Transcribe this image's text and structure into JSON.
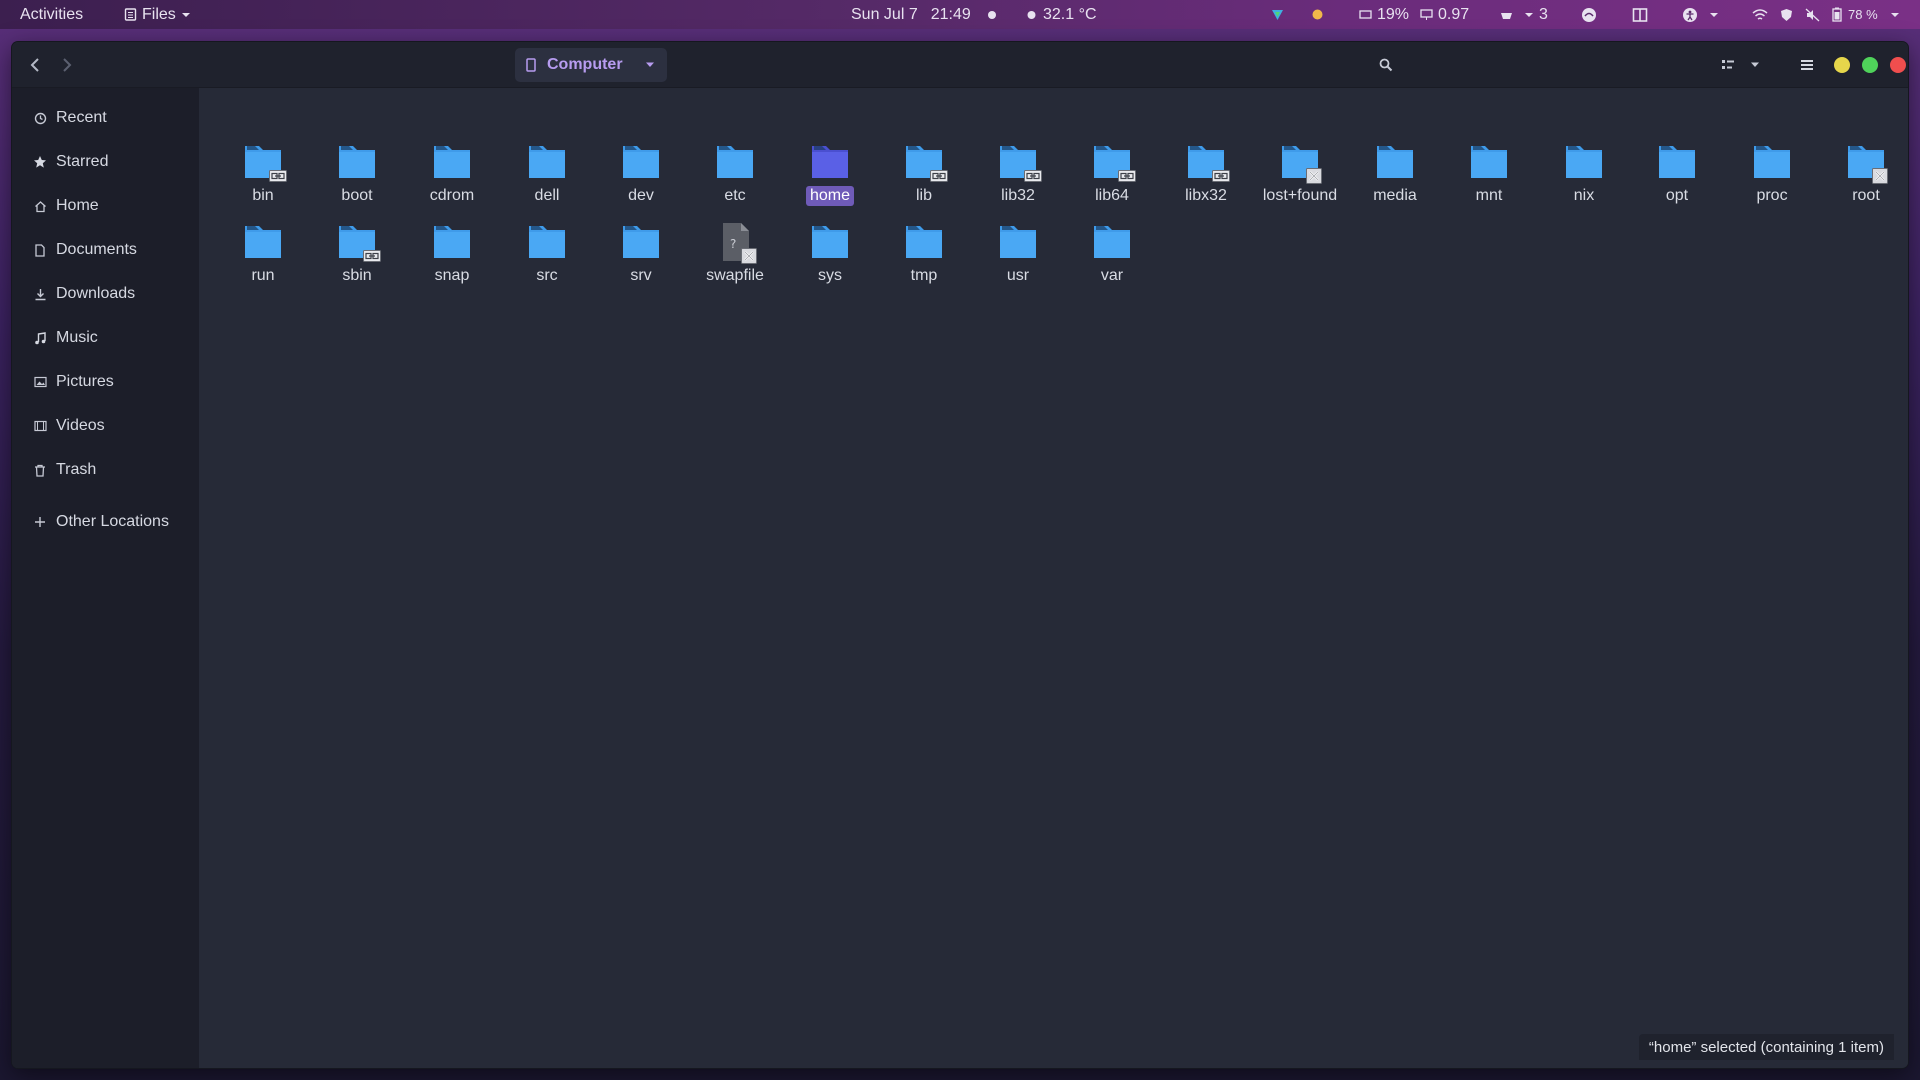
{
  "topbar": {
    "activities": "Activities",
    "app_menu": "Files",
    "date": "Sun Jul 7",
    "time": "21:49",
    "temperature": "32.1 °C",
    "cpu": "19%",
    "load": "0.97",
    "updates_count": "3",
    "battery": "78 %"
  },
  "header": {
    "location": "Computer",
    "colors": {
      "minimize": "#e6d64b",
      "maximize": "#4fd25a",
      "close": "#f04e4e"
    }
  },
  "sidebar": {
    "items": [
      {
        "label": "Recent",
        "icon": "clock-icon"
      },
      {
        "label": "Starred",
        "icon": "star-icon"
      },
      {
        "label": "Home",
        "icon": "home-icon"
      },
      {
        "label": "Documents",
        "icon": "document-icon"
      },
      {
        "label": "Downloads",
        "icon": "download-icon"
      },
      {
        "label": "Music",
        "icon": "music-icon"
      },
      {
        "label": "Pictures",
        "icon": "picture-icon"
      },
      {
        "label": "Videos",
        "icon": "video-icon"
      },
      {
        "label": "Trash",
        "icon": "trash-icon"
      }
    ],
    "other_locations": "Other Locations"
  },
  "files": [
    {
      "name": "bin",
      "emblem": "link"
    },
    {
      "name": "boot",
      "emblem": ""
    },
    {
      "name": "cdrom",
      "emblem": ""
    },
    {
      "name": "dell",
      "emblem": ""
    },
    {
      "name": "dev",
      "emblem": ""
    },
    {
      "name": "etc",
      "emblem": ""
    },
    {
      "name": "home",
      "emblem": "",
      "selected": true
    },
    {
      "name": "lib",
      "emblem": "link"
    },
    {
      "name": "lib32",
      "emblem": "link"
    },
    {
      "name": "lib64",
      "emblem": "link"
    },
    {
      "name": "libx32",
      "emblem": "link"
    },
    {
      "name": "lost+found",
      "emblem": "noaccess"
    },
    {
      "name": "media",
      "emblem": ""
    },
    {
      "name": "mnt",
      "emblem": ""
    },
    {
      "name": "nix",
      "emblem": ""
    },
    {
      "name": "opt",
      "emblem": ""
    },
    {
      "name": "proc",
      "emblem": ""
    },
    {
      "name": "root",
      "emblem": "noaccess"
    },
    {
      "name": "run",
      "emblem": ""
    },
    {
      "name": "sbin",
      "emblem": "link"
    },
    {
      "name": "snap",
      "emblem": ""
    },
    {
      "name": "src",
      "emblem": ""
    },
    {
      "name": "srv",
      "emblem": ""
    },
    {
      "name": "swapfile",
      "emblem": "noaccess",
      "type": "file"
    },
    {
      "name": "sys",
      "emblem": ""
    },
    {
      "name": "tmp",
      "emblem": ""
    },
    {
      "name": "usr",
      "emblem": ""
    },
    {
      "name": "var",
      "emblem": ""
    }
  ],
  "status": "“home” selected  (containing 1 item)"
}
